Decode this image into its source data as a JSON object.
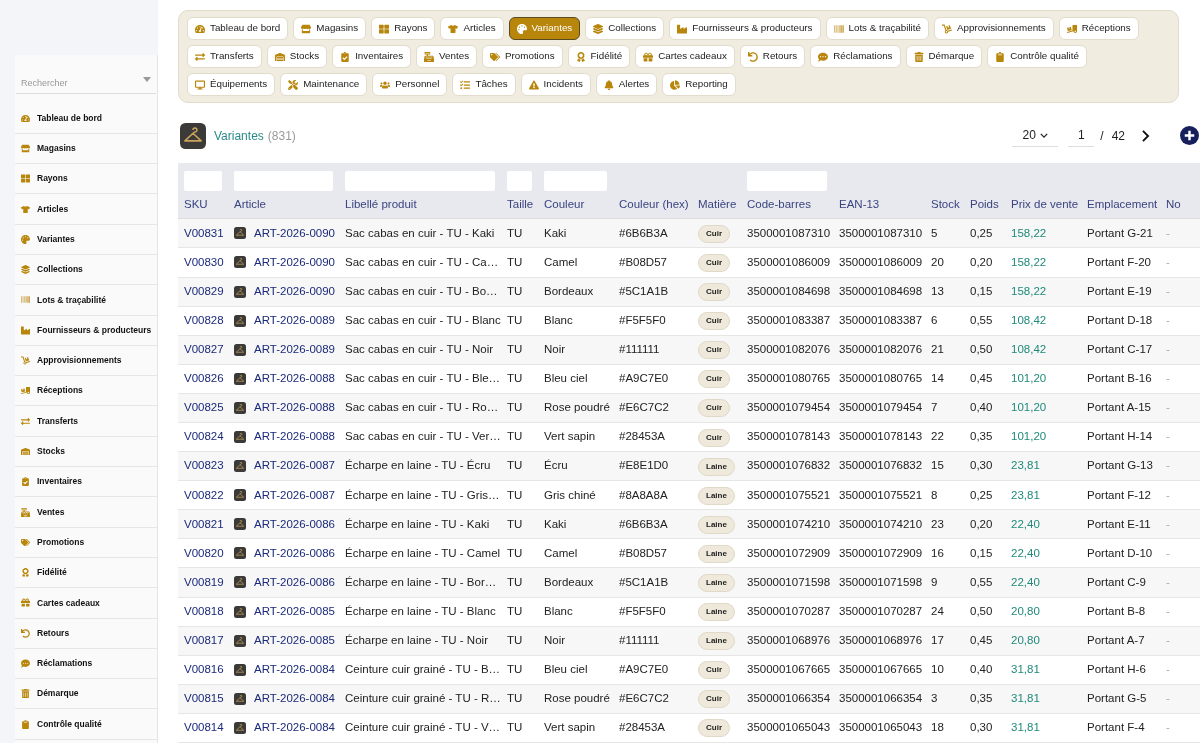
{
  "sidebar": {
    "search": {
      "placeholder": "Rechercher"
    },
    "items": [
      "Tableau de bord",
      "Magasins",
      "Rayons",
      "Articles",
      "Variantes",
      "Collections",
      "Lots & traçabilité",
      "Fournisseurs & producteurs",
      "Approvisionnements",
      "Réceptions",
      "Transferts",
      "Stocks",
      "Inventaires",
      "Ventes",
      "Promotions",
      "Fidélité",
      "Cartes cadeaux",
      "Retours",
      "Réclamations",
      "Démarque",
      "Contrôle qualité"
    ]
  },
  "nav_tabs": [
    {
      "label": "Tableau de bord",
      "selected": false
    },
    {
      "label": "Magasins",
      "selected": false
    },
    {
      "label": "Rayons",
      "selected": false
    },
    {
      "label": "Articles",
      "selected": false
    },
    {
      "label": "Variantes",
      "selected": true
    },
    {
      "label": "Collections",
      "selected": false
    },
    {
      "label": "Fournisseurs & producteurs",
      "selected": false
    },
    {
      "label": "Lots & traçabilité",
      "selected": false
    },
    {
      "label": "Approvisionnements",
      "selected": false
    },
    {
      "label": "Réceptions",
      "selected": false
    },
    {
      "label": "Transferts",
      "selected": false
    },
    {
      "label": "Stocks",
      "selected": false
    },
    {
      "label": "Inventaires",
      "selected": false
    },
    {
      "label": "Ventes",
      "selected": false
    },
    {
      "label": "Promotions",
      "selected": false
    },
    {
      "label": "Fidélité",
      "selected": false
    },
    {
      "label": "Cartes cadeaux",
      "selected": false
    },
    {
      "label": "Retours",
      "selected": false
    },
    {
      "label": "Réclamations",
      "selected": false
    },
    {
      "label": "Démarque",
      "selected": false
    },
    {
      "label": "Contrôle qualité",
      "selected": false
    },
    {
      "label": "Équipements",
      "selected": false
    },
    {
      "label": "Maintenance",
      "selected": false
    },
    {
      "label": "Personnel",
      "selected": false
    },
    {
      "label": "Tâches",
      "selected": false
    },
    {
      "label": "Incidents",
      "selected": false
    },
    {
      "label": "Alertes",
      "selected": false
    },
    {
      "label": "Reporting",
      "selected": false
    }
  ],
  "header": {
    "title": "Variantes",
    "count": "(831)",
    "page_size": "20",
    "page": "1",
    "separator": "/",
    "page_count": "42"
  },
  "table": {
    "columns": [
      {
        "label": "SKU",
        "filter": true
      },
      {
        "label": "Article",
        "filter": true
      },
      {
        "label": "Libellé produit",
        "filter": true
      },
      {
        "label": "Taille",
        "filter": true
      },
      {
        "label": "Couleur",
        "filter": true
      },
      {
        "label": "Couleur (hex)",
        "filter": false
      },
      {
        "label": "Matière",
        "filter": false
      },
      {
        "label": "Code-barres",
        "filter": true
      },
      {
        "label": "EAN-13",
        "filter": false
      },
      {
        "label": "Stock",
        "filter": false
      },
      {
        "label": "Poids",
        "filter": false
      },
      {
        "label": "Prix de vente",
        "filter": false
      },
      {
        "label": "Emplacement",
        "filter": false
      },
      {
        "label": "No",
        "filter": false
      }
    ],
    "rows": [
      [
        "V00831",
        "ART-2026-0090",
        "Sac cabas en cuir - TU - Kaki",
        "TU",
        "Kaki",
        "#6B6B3A",
        "Cuir",
        "3500001087310",
        "3500001087310",
        "5",
        "0,25",
        "158,22",
        "Portant G-21",
        "-"
      ],
      [
        "V00830",
        "ART-2026-0090",
        "Sac cabas en cuir - TU - Ca…",
        "TU",
        "Camel",
        "#B08D57",
        "Cuir",
        "3500001086009",
        "3500001086009",
        "20",
        "0,20",
        "158,22",
        "Portant F-20",
        "-"
      ],
      [
        "V00829",
        "ART-2026-0090",
        "Sac cabas en cuir - TU - Bo…",
        "TU",
        "Bordeaux",
        "#5C1A1B",
        "Cuir",
        "3500001084698",
        "3500001084698",
        "13",
        "0,15",
        "158,22",
        "Portant E-19",
        "-"
      ],
      [
        "V00828",
        "ART-2026-0089",
        "Sac cabas en cuir - TU - Blanc",
        "TU",
        "Blanc",
        "#F5F5F0",
        "Cuir",
        "3500001083387",
        "3500001083387",
        "6",
        "0,55",
        "108,42",
        "Portant D-18",
        "-"
      ],
      [
        "V00827",
        "ART-2026-0089",
        "Sac cabas en cuir - TU - Noir",
        "TU",
        "Noir",
        "#111111",
        "Cuir",
        "3500001082076",
        "3500001082076",
        "21",
        "0,50",
        "108,42",
        "Portant C-17",
        "-"
      ],
      [
        "V00826",
        "ART-2026-0088",
        "Sac cabas en cuir - TU - Ble…",
        "TU",
        "Bleu ciel",
        "#A9C7E0",
        "Cuir",
        "3500001080765",
        "3500001080765",
        "14",
        "0,45",
        "101,20",
        "Portant B-16",
        "-"
      ],
      [
        "V00825",
        "ART-2026-0088",
        "Sac cabas en cuir - TU - Ro…",
        "TU",
        "Rose poudré",
        "#E6C7C2",
        "Cuir",
        "3500001079454",
        "3500001079454",
        "7",
        "0,40",
        "101,20",
        "Portant A-15",
        "-"
      ],
      [
        "V00824",
        "ART-2026-0088",
        "Sac cabas en cuir - TU - Ver…",
        "TU",
        "Vert sapin",
        "#28453A",
        "Cuir",
        "3500001078143",
        "3500001078143",
        "22",
        "0,35",
        "101,20",
        "Portant H-14",
        "-"
      ],
      [
        "V00823",
        "ART-2026-0087",
        "Écharpe en laine - TU - Écru",
        "TU",
        "Écru",
        "#E8E1D0",
        "Laine",
        "3500001076832",
        "3500001076832",
        "15",
        "0,30",
        "23,81",
        "Portant G-13",
        "-"
      ],
      [
        "V00822",
        "ART-2026-0087",
        "Écharpe en laine - TU - Gris…",
        "TU",
        "Gris chiné",
        "#8A8A8A",
        "Laine",
        "3500001075521",
        "3500001075521",
        "8",
        "0,25",
        "23,81",
        "Portant F-12",
        "-"
      ],
      [
        "V00821",
        "ART-2026-0086",
        "Écharpe en laine - TU - Kaki",
        "TU",
        "Kaki",
        "#6B6B3A",
        "Laine",
        "3500001074210",
        "3500001074210",
        "23",
        "0,20",
        "22,40",
        "Portant E-11",
        "-"
      ],
      [
        "V00820",
        "ART-2026-0086",
        "Écharpe en laine - TU - Camel",
        "TU",
        "Camel",
        "#B08D57",
        "Laine",
        "3500001072909",
        "3500001072909",
        "16",
        "0,15",
        "22,40",
        "Portant D-10",
        "-"
      ],
      [
        "V00819",
        "ART-2026-0086",
        "Écharpe en laine - TU - Bor…",
        "TU",
        "Bordeaux",
        "#5C1A1B",
        "Laine",
        "3500001071598",
        "3500001071598",
        "9",
        "0,55",
        "22,40",
        "Portant C-9",
        "-"
      ],
      [
        "V00818",
        "ART-2026-0085",
        "Écharpe en laine - TU - Blanc",
        "TU",
        "Blanc",
        "#F5F5F0",
        "Laine",
        "3500001070287",
        "3500001070287",
        "24",
        "0,50",
        "20,80",
        "Portant B-8",
        "-"
      ],
      [
        "V00817",
        "ART-2026-0085",
        "Écharpe en laine - TU - Noir",
        "TU",
        "Noir",
        "#111111",
        "Laine",
        "3500001068976",
        "3500001068976",
        "17",
        "0,45",
        "20,80",
        "Portant A-7",
        "-"
      ],
      [
        "V00816",
        "ART-2026-0084",
        "Ceinture cuir grainé - TU - B…",
        "TU",
        "Bleu ciel",
        "#A9C7E0",
        "Cuir",
        "3500001067665",
        "3500001067665",
        "10",
        "0,40",
        "31,81",
        "Portant H-6",
        "-"
      ],
      [
        "V00815",
        "ART-2026-0084",
        "Ceinture cuir grainé - TU - R…",
        "TU",
        "Rose poudré",
        "#E6C7C2",
        "Cuir",
        "3500001066354",
        "3500001066354",
        "3",
        "0,35",
        "31,81",
        "Portant G-5",
        "-"
      ],
      [
        "V00814",
        "ART-2026-0084",
        "Ceinture cuir grainé - TU - V…",
        "TU",
        "Vert sapin",
        "#28453A",
        "Cuir",
        "3500001065043",
        "3500001065043",
        "18",
        "0,30",
        "31,81",
        "Portant F-4",
        "-"
      ]
    ]
  }
}
